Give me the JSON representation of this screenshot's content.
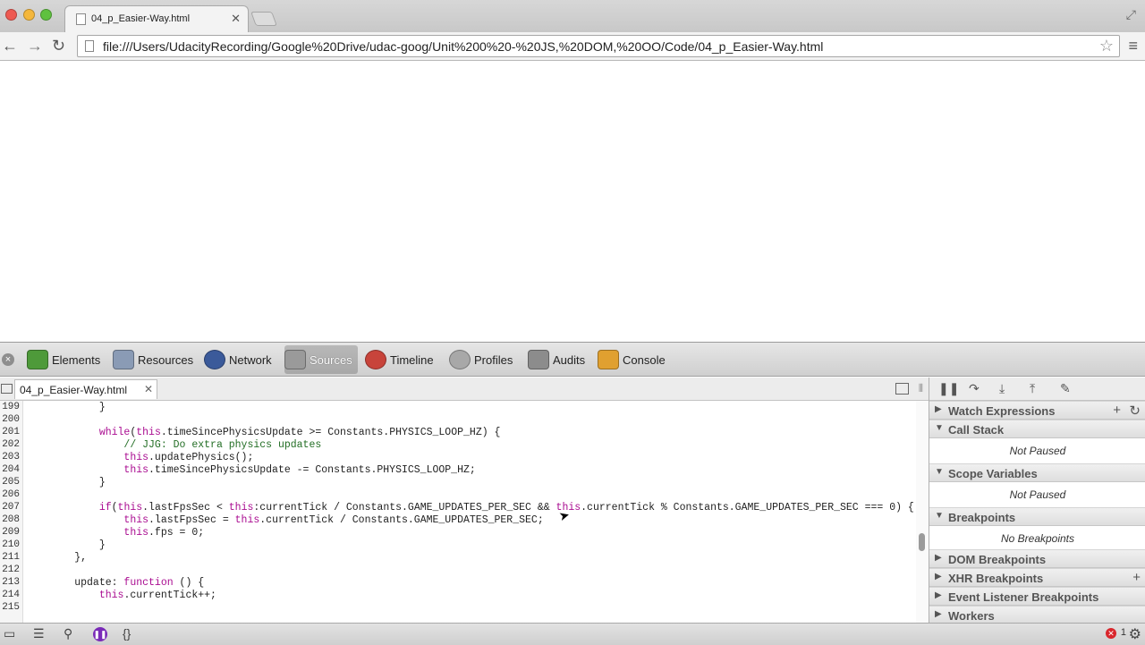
{
  "browser": {
    "tab_title": "04_p_Easier-Way.html",
    "tab_close": "✕",
    "url": "file:///Users/UdacityRecording/Google%20Drive/udac-goog/Unit%200%20-%20JS,%20DOM,%20OO/Code/04_p_Easier-Way.html",
    "back": "←",
    "forward": "→",
    "reload": "↻",
    "star": "☆",
    "menu": "≡",
    "fullscreen": "⤢"
  },
  "devtools": {
    "close": "×",
    "panels": [
      {
        "label": "Elements",
        "color": "#4e9a3a"
      },
      {
        "label": "Resources",
        "color": "#8a9bb5"
      },
      {
        "label": "Network",
        "color": "#3b5a9a"
      },
      {
        "label": "Sources",
        "color": "#9a9a9a"
      },
      {
        "label": "Timeline",
        "color": "#c8443b"
      },
      {
        "label": "Profiles",
        "color": "#a8a8a8"
      },
      {
        "label": "Audits",
        "color": "#8c8c8c"
      },
      {
        "label": "Console",
        "color": "#e0a030"
      }
    ],
    "file_tab": {
      "title": "04_p_Easier-Way.html",
      "close": "✕"
    },
    "split": "⦀",
    "code_lines": [
      {
        "n": "199",
        "html": "            }"
      },
      {
        "n": "200",
        "html": ""
      },
      {
        "n": "201",
        "html": "            <span class=\"kw\">while</span>(<span class=\"kw\">this</span>.timeSincePhysicsUpdate >= Constants.PHYSICS_LOOP_HZ) {"
      },
      {
        "n": "202",
        "html": "                <span class=\"cm\">// JJG: Do extra physics updates</span>"
      },
      {
        "n": "203",
        "html": "                <span class=\"kw\">this</span>.updatePhysics();"
      },
      {
        "n": "204",
        "html": "                <span class=\"kw\">this</span>.timeSincePhysicsUpdate -= Constants.PHYSICS_LOOP_HZ;"
      },
      {
        "n": "205",
        "html": "            }"
      },
      {
        "n": "206",
        "html": ""
      },
      {
        "n": "207",
        "html": "            <span class=\"kw\">if</span>(<span class=\"kw\">this</span>.lastFpsSec < <span class=\"kw\">this</span>:currentTick / Constants.GAME_UPDATES_PER_SEC && <span class=\"kw\">this</span>.currentTick % Constants.GAME_UPDATES_PER_SEC === 0) {"
      },
      {
        "n": "208",
        "html": "                <span class=\"kw\">this</span>.lastFpsSec = <span class=\"kw\">this</span>.currentTick / Constants.GAME_UPDATES_PER_SEC;"
      },
      {
        "n": "209",
        "html": "                <span class=\"kw\">this</span>.fps = 0;"
      },
      {
        "n": "210",
        "html": "            }"
      },
      {
        "n": "211",
        "html": "        },"
      },
      {
        "n": "212",
        "html": ""
      },
      {
        "n": "213",
        "html": "        update: <span class=\"kw\">function</span> () {"
      },
      {
        "n": "214",
        "html": "            <span class=\"kw\">this</span>.currentTick++;"
      },
      {
        "n": "215",
        "html": ""
      }
    ],
    "debug_buttons": [
      "❚❚",
      "↷",
      "⤓",
      "⤒",
      "✎"
    ],
    "sidebar": {
      "watch": {
        "title": "Watch Expressions",
        "add": "+",
        "refresh": "↻"
      },
      "callstack": {
        "title": "Call Stack",
        "body": "Not Paused"
      },
      "scope": {
        "title": "Scope Variables",
        "body": "Not Paused"
      },
      "breakpoints": {
        "title": "Breakpoints",
        "body": "No Breakpoints"
      },
      "dom_bp": {
        "title": "DOM Breakpoints"
      },
      "xhr_bp": {
        "title": "XHR Breakpoints",
        "add": "+"
      },
      "event_bp": {
        "title": "Event Listener Breakpoints"
      },
      "workers": {
        "title": "Workers"
      }
    },
    "status": {
      "dock": "▭",
      "console_toggle": "☰",
      "search": "⚲",
      "pause_exceptions": "❚❚",
      "pretty_print": "{}",
      "error_count": "1",
      "error_glyph": "✕",
      "settings": "⚙"
    }
  }
}
